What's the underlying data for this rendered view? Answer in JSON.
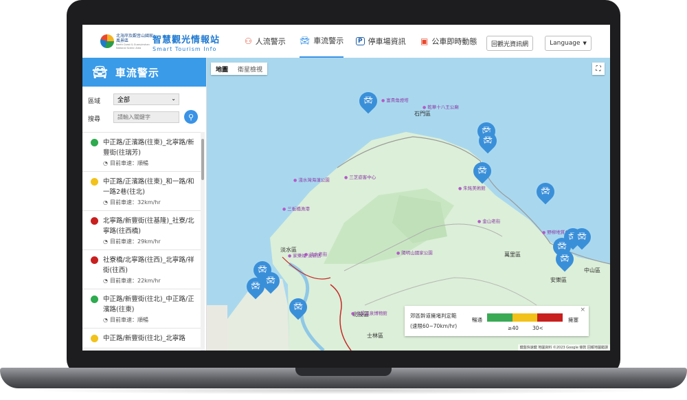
{
  "header": {
    "org_zh": "北海岸及觀音山國家風景區",
    "org_en": "North Coast & Guanyinshan National Scenic Area",
    "brand_zh": "智慧觀光情報站",
    "brand_en": "Smart Tourism Info",
    "nav": [
      {
        "label": "人流警示",
        "icon": "people-icon"
      },
      {
        "label": "車流警示",
        "icon": "car-icon"
      },
      {
        "label": "停車場資訊",
        "icon": "parking-icon"
      },
      {
        "label": "公車即時動態",
        "icon": "bus-icon"
      }
    ],
    "back_label": "回觀光資訊網",
    "language_label": "Language"
  },
  "sidebar": {
    "title": "車流警示",
    "region_label": "區域",
    "region_value": "全部",
    "search_label": "搜尋",
    "search_placeholder": "請輸入關鍵字",
    "items": [
      {
        "title": "中正路/正濱路(往東)_北寧路/新豐街(往瑞芳)",
        "speed": "目前車速：順暢",
        "color": "#2eaa4f"
      },
      {
        "title": "中正路/正濱路(往東)_和一路/和一路2巷(往北)",
        "speed": "目前車速：32km/hr",
        "color": "#f2c21b"
      },
      {
        "title": "北寧路/新豐街(往基隆)_社寮/北寧路(往西橋)",
        "speed": "目前車速：29km/hr",
        "color": "#c81f1f"
      },
      {
        "title": "社寮橋/北寧路(往西)_北寧路/祥街(往西)",
        "speed": "目前車速：22km/hr",
        "color": "#c81f1f"
      },
      {
        "title": "中正路/新豐街(往北)_中正路/正濱路(往東)",
        "speed": "目前車速：順暢",
        "color": "#2eaa4f"
      },
      {
        "title": "中正路/新豐街(往北)_北寧路",
        "speed": "",
        "color": "#f2c21b"
      }
    ]
  },
  "map": {
    "tab_map": "地圖",
    "tab_satellite": "衛星檢視",
    "districts": [
      "石門區",
      "淡水區",
      "萬里區",
      "北投區",
      "士林區",
      "中山區",
      "安樂區"
    ],
    "pois": [
      "富貴角燈塔",
      "乾華十八王公廟",
      "朱銘美術館",
      "三芝遊客中心",
      "淺水灣海濱公園",
      "三板橋漁港",
      "陽明山國家公園",
      "金山老街",
      "野柳地質公園",
      "北投溫泉博物館",
      "淡水老街",
      "家樂福 淡新店"
    ],
    "legend": {
      "title": "郊區幹道擁堵判定範",
      "subtitle": "(速限60~70km/hr)",
      "flow": "暢通",
      "congested": "擁塞",
      "tick_40": "≥40",
      "tick_30": "30<",
      "colors": [
        "#3aaa55",
        "#f2c21b",
        "#c81f1f"
      ]
    },
    "attribution": "鍵盤快速鍵  地圖資料 ©2023 Google  條款  回報地圖錯誤",
    "close": "×"
  }
}
